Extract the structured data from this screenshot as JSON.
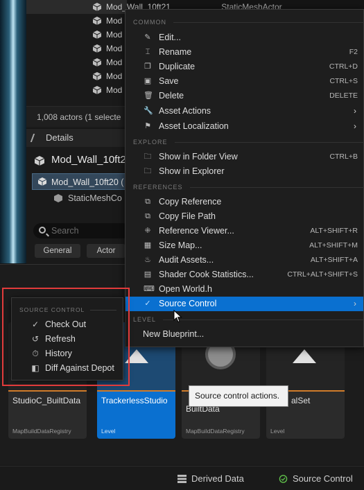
{
  "outliner": {
    "rows": [
      {
        "label": "Mod_Wall_10ft21",
        "type": "StaticMeshActor"
      },
      {
        "label": "Mod"
      },
      {
        "label": "Mod"
      },
      {
        "label": "Mod"
      },
      {
        "label": "Mod"
      },
      {
        "label": "Mod"
      },
      {
        "label": "Mod"
      },
      {
        "label": "Mod"
      }
    ],
    "actor_count": "1,008 actors (1 selecte"
  },
  "details": {
    "tab_label": "Details",
    "actor_name": "Mod_Wall_10ft2",
    "component": "Mod_Wall_10ft20 (",
    "sub_component": "StaticMeshCo",
    "search_placeholder": "Search",
    "chips": [
      "General",
      "Actor"
    ]
  },
  "context_menu": {
    "sections": {
      "common": "COMMON",
      "explore": "EXPLORE",
      "references": "REFERENCES",
      "level": "LEVEL"
    },
    "items": [
      {
        "label": "Edit...",
        "icon": "pencil-icon",
        "shortcut": ""
      },
      {
        "label": "Rename",
        "icon": "rename-icon",
        "shortcut": "F2"
      },
      {
        "label": "Duplicate",
        "icon": "duplicate-icon",
        "shortcut": "CTRL+D"
      },
      {
        "label": "Save",
        "icon": "save-icon",
        "shortcut": "CTRL+S"
      },
      {
        "label": "Delete",
        "icon": "trash-icon",
        "shortcut": "DELETE"
      },
      {
        "label": "Asset Actions",
        "icon": "wrench-icon",
        "shortcut": "",
        "submenu": true
      },
      {
        "label": "Asset Localization",
        "icon": "flag-icon",
        "shortcut": "",
        "submenu": true
      },
      {
        "label": "Show in Folder View",
        "icon": "folder-search-icon",
        "shortcut": "CTRL+B"
      },
      {
        "label": "Show in Explorer",
        "icon": "folder-search-icon",
        "shortcut": ""
      },
      {
        "label": "Copy Reference",
        "icon": "copy-icon",
        "shortcut": ""
      },
      {
        "label": "Copy File Path",
        "icon": "copy-icon",
        "shortcut": ""
      },
      {
        "label": "Reference Viewer...",
        "icon": "reference-viewer-icon",
        "shortcut": "ALT+SHIFT+R"
      },
      {
        "label": "Size Map...",
        "icon": "size-map-icon",
        "shortcut": "ALT+SHIFT+M"
      },
      {
        "label": "Audit Assets...",
        "icon": "audit-icon",
        "shortcut": "ALT+SHIFT+A"
      },
      {
        "label": "Shader Cook Statistics...",
        "icon": "shader-stats-icon",
        "shortcut": "CTRL+ALT+SHIFT+S"
      },
      {
        "label": "Open World.h",
        "icon": "code-file-icon",
        "shortcut": ""
      },
      {
        "label": "Source Control",
        "icon": "check-circle-icon",
        "shortcut": "",
        "submenu": true,
        "highlighted": true
      },
      {
        "label": "New Blueprint...",
        "icon": "",
        "shortcut": ""
      }
    ]
  },
  "source_control_submenu": {
    "section": "SOURCE CONTROL",
    "items": [
      {
        "label": "Check Out",
        "icon": "checkmark-icon"
      },
      {
        "label": "Refresh",
        "icon": "refresh-icon"
      },
      {
        "label": "History",
        "icon": "history-icon"
      },
      {
        "label": "Diff Against Depot",
        "icon": "diff-icon"
      }
    ]
  },
  "tooltip": "Source control actions.",
  "content_browser": {
    "tiles": [
      {
        "name": "StudioC_BuiltData",
        "type": "MapBuildDataRegistry",
        "selected": false
      },
      {
        "name": "TrackerlessStudio",
        "type": "Level",
        "selected": true
      },
      {
        "name": "BuiltData",
        "type": "MapBuildDataRegistry",
        "selected": false
      },
      {
        "name": "alSet",
        "type": "Level",
        "selected": false
      }
    ]
  },
  "statusbar": {
    "derived_data": "Derived Data",
    "source_control": "Source Control"
  },
  "colors": {
    "highlight": "#0a70d0",
    "red_outline": "#e23b3b",
    "asset_bar": "#d17c2a"
  }
}
